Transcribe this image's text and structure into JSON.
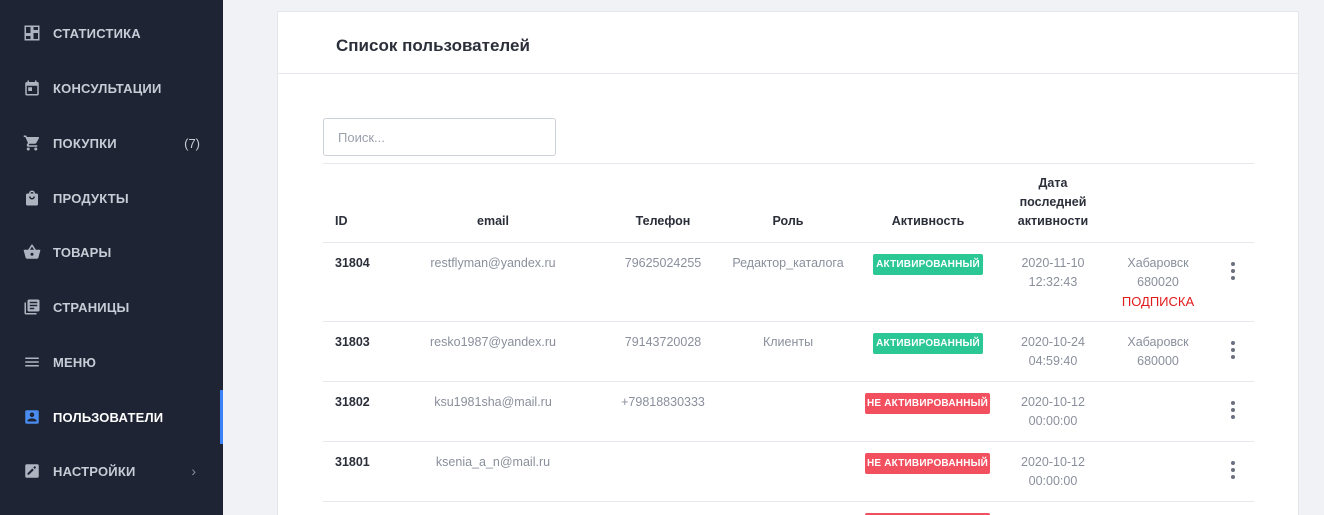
{
  "sidebar": {
    "items": [
      {
        "label": "СТАТИСТИКА",
        "icon": "dashboard-icon"
      },
      {
        "label": "КОНСУЛЬТАЦИИ",
        "icon": "calendar-icon"
      },
      {
        "label": "ПОКУПКИ",
        "icon": "cart-icon",
        "count": "(7)"
      },
      {
        "label": "ПРОДУКТЫ",
        "icon": "shopping-bag-icon"
      },
      {
        "label": "ТОВАРЫ",
        "icon": "basket-icon"
      },
      {
        "label": "СТРАНИЦЫ",
        "icon": "pages-icon"
      },
      {
        "label": "МЕНЮ",
        "icon": "menu-icon"
      },
      {
        "label": "ПОЛЬЗОВАТЕЛИ",
        "icon": "user-icon",
        "active": true
      },
      {
        "label": "НАСТРОЙКИ",
        "icon": "edit-icon",
        "chevron": "›"
      }
    ]
  },
  "main": {
    "title": "Список пользователей",
    "search": {
      "placeholder": "Поиск...",
      "value": ""
    },
    "table": {
      "headers": {
        "id": "ID",
        "email": "email",
        "phone": "Телефон",
        "role": "Роль",
        "activity": "Активность",
        "last_activity_1": "Дата",
        "last_activity_2": "последней",
        "last_activity_3": "активности"
      },
      "rows": [
        {
          "id": "31804",
          "email": "restflyman@yandex.ru",
          "phone": "79625024255",
          "role": "Редактор_каталога",
          "status": "АКТИВИРОВАННЫЙ",
          "date": "2020-11-10",
          "time": "12:32:43",
          "city": "Хабаровск",
          "zip": "680020",
          "subscription": "ПОДПИСКА"
        },
        {
          "id": "31803",
          "email": "resko1987@yandex.ru",
          "phone": "79143720028",
          "role": "Клиенты",
          "status": "АКТИВИРОВАННЫЙ",
          "date": "2020-10-24",
          "time": "04:59:40",
          "city": "Хабаровск",
          "zip": "680000"
        },
        {
          "id": "31802",
          "email": "ksu1981sha@mail.ru",
          "phone": "+79818830333",
          "role": "",
          "status": "НЕ АКТИВИРОВАННЫЙ",
          "date": "2020-10-12",
          "time": "00:00:00"
        },
        {
          "id": "31801",
          "email": "ksenia_a_n@mail.ru",
          "phone": "",
          "role": "",
          "status": "НЕ АКТИВИРОВАННЫЙ",
          "date": "2020-10-12",
          "time": "00:00:00"
        }
      ]
    }
  },
  "colors": {
    "sidebar_bg": "#1e2433",
    "active_accent": "#3b82f6",
    "badge_active": "#2bc795",
    "badge_inactive": "#f2505f",
    "subscription": "#e11c1c"
  }
}
